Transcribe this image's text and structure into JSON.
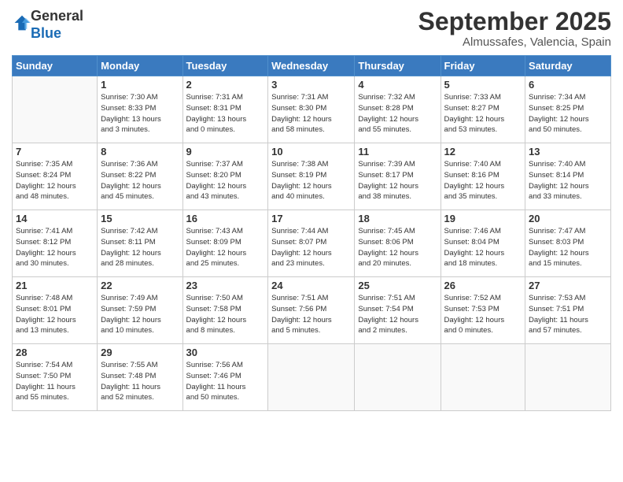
{
  "logo": {
    "general": "General",
    "blue": "Blue"
  },
  "header": {
    "month": "September 2025",
    "location": "Almussafes, Valencia, Spain"
  },
  "weekdays": [
    "Sunday",
    "Monday",
    "Tuesday",
    "Wednesday",
    "Thursday",
    "Friday",
    "Saturday"
  ],
  "weeks": [
    [
      {
        "day": "",
        "info": ""
      },
      {
        "day": "1",
        "info": "Sunrise: 7:30 AM\nSunset: 8:33 PM\nDaylight: 13 hours\nand 3 minutes."
      },
      {
        "day": "2",
        "info": "Sunrise: 7:31 AM\nSunset: 8:31 PM\nDaylight: 13 hours\nand 0 minutes."
      },
      {
        "day": "3",
        "info": "Sunrise: 7:31 AM\nSunset: 8:30 PM\nDaylight: 12 hours\nand 58 minutes."
      },
      {
        "day": "4",
        "info": "Sunrise: 7:32 AM\nSunset: 8:28 PM\nDaylight: 12 hours\nand 55 minutes."
      },
      {
        "day": "5",
        "info": "Sunrise: 7:33 AM\nSunset: 8:27 PM\nDaylight: 12 hours\nand 53 minutes."
      },
      {
        "day": "6",
        "info": "Sunrise: 7:34 AM\nSunset: 8:25 PM\nDaylight: 12 hours\nand 50 minutes."
      }
    ],
    [
      {
        "day": "7",
        "info": "Sunrise: 7:35 AM\nSunset: 8:24 PM\nDaylight: 12 hours\nand 48 minutes."
      },
      {
        "day": "8",
        "info": "Sunrise: 7:36 AM\nSunset: 8:22 PM\nDaylight: 12 hours\nand 45 minutes."
      },
      {
        "day": "9",
        "info": "Sunrise: 7:37 AM\nSunset: 8:20 PM\nDaylight: 12 hours\nand 43 minutes."
      },
      {
        "day": "10",
        "info": "Sunrise: 7:38 AM\nSunset: 8:19 PM\nDaylight: 12 hours\nand 40 minutes."
      },
      {
        "day": "11",
        "info": "Sunrise: 7:39 AM\nSunset: 8:17 PM\nDaylight: 12 hours\nand 38 minutes."
      },
      {
        "day": "12",
        "info": "Sunrise: 7:40 AM\nSunset: 8:16 PM\nDaylight: 12 hours\nand 35 minutes."
      },
      {
        "day": "13",
        "info": "Sunrise: 7:40 AM\nSunset: 8:14 PM\nDaylight: 12 hours\nand 33 minutes."
      }
    ],
    [
      {
        "day": "14",
        "info": "Sunrise: 7:41 AM\nSunset: 8:12 PM\nDaylight: 12 hours\nand 30 minutes."
      },
      {
        "day": "15",
        "info": "Sunrise: 7:42 AM\nSunset: 8:11 PM\nDaylight: 12 hours\nand 28 minutes."
      },
      {
        "day": "16",
        "info": "Sunrise: 7:43 AM\nSunset: 8:09 PM\nDaylight: 12 hours\nand 25 minutes."
      },
      {
        "day": "17",
        "info": "Sunrise: 7:44 AM\nSunset: 8:07 PM\nDaylight: 12 hours\nand 23 minutes."
      },
      {
        "day": "18",
        "info": "Sunrise: 7:45 AM\nSunset: 8:06 PM\nDaylight: 12 hours\nand 20 minutes."
      },
      {
        "day": "19",
        "info": "Sunrise: 7:46 AM\nSunset: 8:04 PM\nDaylight: 12 hours\nand 18 minutes."
      },
      {
        "day": "20",
        "info": "Sunrise: 7:47 AM\nSunset: 8:03 PM\nDaylight: 12 hours\nand 15 minutes."
      }
    ],
    [
      {
        "day": "21",
        "info": "Sunrise: 7:48 AM\nSunset: 8:01 PM\nDaylight: 12 hours\nand 13 minutes."
      },
      {
        "day": "22",
        "info": "Sunrise: 7:49 AM\nSunset: 7:59 PM\nDaylight: 12 hours\nand 10 minutes."
      },
      {
        "day": "23",
        "info": "Sunrise: 7:50 AM\nSunset: 7:58 PM\nDaylight: 12 hours\nand 8 minutes."
      },
      {
        "day": "24",
        "info": "Sunrise: 7:51 AM\nSunset: 7:56 PM\nDaylight: 12 hours\nand 5 minutes."
      },
      {
        "day": "25",
        "info": "Sunrise: 7:51 AM\nSunset: 7:54 PM\nDaylight: 12 hours\nand 2 minutes."
      },
      {
        "day": "26",
        "info": "Sunrise: 7:52 AM\nSunset: 7:53 PM\nDaylight: 12 hours\nand 0 minutes."
      },
      {
        "day": "27",
        "info": "Sunrise: 7:53 AM\nSunset: 7:51 PM\nDaylight: 11 hours\nand 57 minutes."
      }
    ],
    [
      {
        "day": "28",
        "info": "Sunrise: 7:54 AM\nSunset: 7:50 PM\nDaylight: 11 hours\nand 55 minutes."
      },
      {
        "day": "29",
        "info": "Sunrise: 7:55 AM\nSunset: 7:48 PM\nDaylight: 11 hours\nand 52 minutes."
      },
      {
        "day": "30",
        "info": "Sunrise: 7:56 AM\nSunset: 7:46 PM\nDaylight: 11 hours\nand 50 minutes."
      },
      {
        "day": "",
        "info": ""
      },
      {
        "day": "",
        "info": ""
      },
      {
        "day": "",
        "info": ""
      },
      {
        "day": "",
        "info": ""
      }
    ]
  ]
}
